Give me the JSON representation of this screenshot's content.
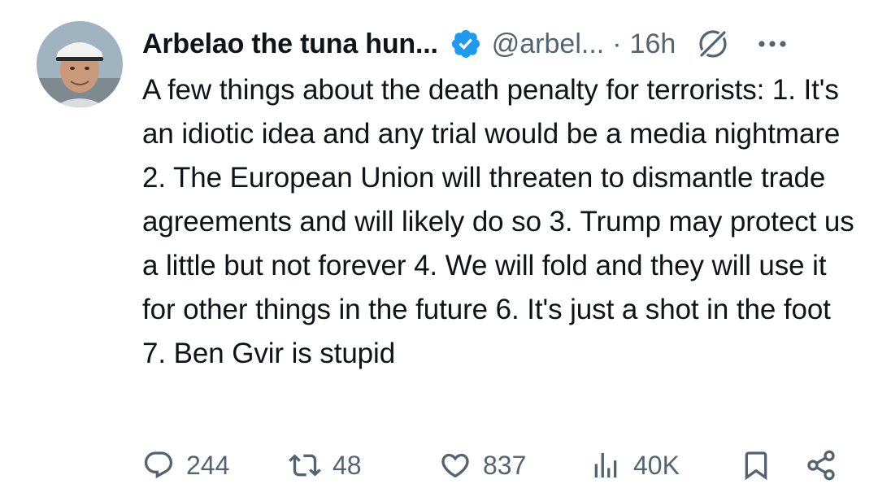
{
  "tweet": {
    "author": {
      "display_name": "Arbelao the tuna hun...",
      "handle": "@arbel...",
      "verified": true
    },
    "separator": "·",
    "timestamp": "16h",
    "text": "A few things about the death penalty for terrorists: 1. It's an idiotic idea and any trial would be a media nightmare 2. The European Union will threaten to dismantle trade agreements and will likely do so 3. Trump may protect us a little but not forever 4. We will fold and they will use it for other things in the future 6. It's just a shot in the foot 7. Ben Gvir is stupid",
    "stats": {
      "replies": "244",
      "reposts": "48",
      "likes": "837",
      "views": "40K"
    }
  },
  "icons": {
    "verified": "verified-badge-icon",
    "grok": "grok-icon",
    "more": "more-icon",
    "reply": "reply-icon",
    "repost": "repost-icon",
    "like": "heart-icon",
    "views": "views-icon",
    "bookmark": "bookmark-icon",
    "share": "share-icon"
  },
  "colors": {
    "text_primary": "#0f1419",
    "text_secondary": "#536471",
    "verified_blue": "#1d9bf0"
  }
}
